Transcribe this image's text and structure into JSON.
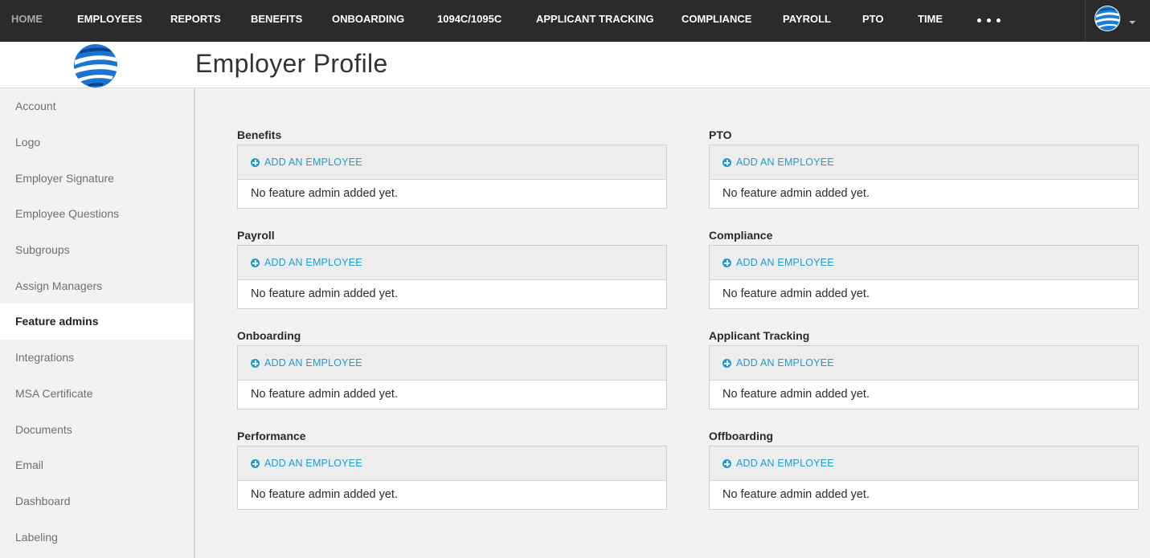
{
  "topnav": {
    "items": [
      "HOME",
      "EMPLOYEES",
      "REPORTS",
      "BENEFITS",
      "ONBOARDING",
      "1094C/1095C",
      "APPLICANT TRACKING",
      "COMPLIANCE",
      "PAYROLL",
      "PTO",
      "TIME"
    ],
    "more_icon": "more-dots-icon",
    "avatar_icon": "globe-logo-icon",
    "caret_icon": "caret-down-icon",
    "color": "#2b2b2b"
  },
  "header": {
    "title": "Employer Profile",
    "logo_icon": "globe-logo-icon"
  },
  "sidebar": {
    "items": [
      "Account",
      "Logo",
      "Employer Signature",
      "Employee Questions",
      "Subgroups",
      "Assign Managers",
      "Feature admins",
      "Integrations",
      "MSA Certificate",
      "Documents",
      "Email",
      "Dashboard",
      "Labeling"
    ],
    "active": "Feature admins"
  },
  "sections": [
    {
      "title": "Benefits",
      "add_label": "ADD AN EMPLOYEE",
      "empty_text": "No feature admin added yet."
    },
    {
      "title": "PTO",
      "add_label": "ADD AN EMPLOYEE",
      "empty_text": "No feature admin added yet."
    },
    {
      "title": "Payroll",
      "add_label": "ADD AN EMPLOYEE",
      "empty_text": "No feature admin added yet."
    },
    {
      "title": "Compliance",
      "add_label": "ADD AN EMPLOYEE",
      "empty_text": "No feature admin added yet."
    },
    {
      "title": "Onboarding",
      "add_label": "ADD AN EMPLOYEE",
      "empty_text": "No feature admin added yet."
    },
    {
      "title": "Applicant Tracking",
      "add_label": "ADD AN EMPLOYEE",
      "empty_text": "No feature admin added yet."
    },
    {
      "title": "Performance",
      "add_label": "ADD AN EMPLOYEE",
      "empty_text": "No feature admin added yet."
    },
    {
      "title": "Offboarding",
      "add_label": "ADD AN EMPLOYEE",
      "empty_text": "No feature admin added yet."
    }
  ],
  "colors": {
    "accent": "#1f9ccf",
    "nav_bg": "#2b2b2b",
    "page_bg": "#f2f2f2"
  }
}
